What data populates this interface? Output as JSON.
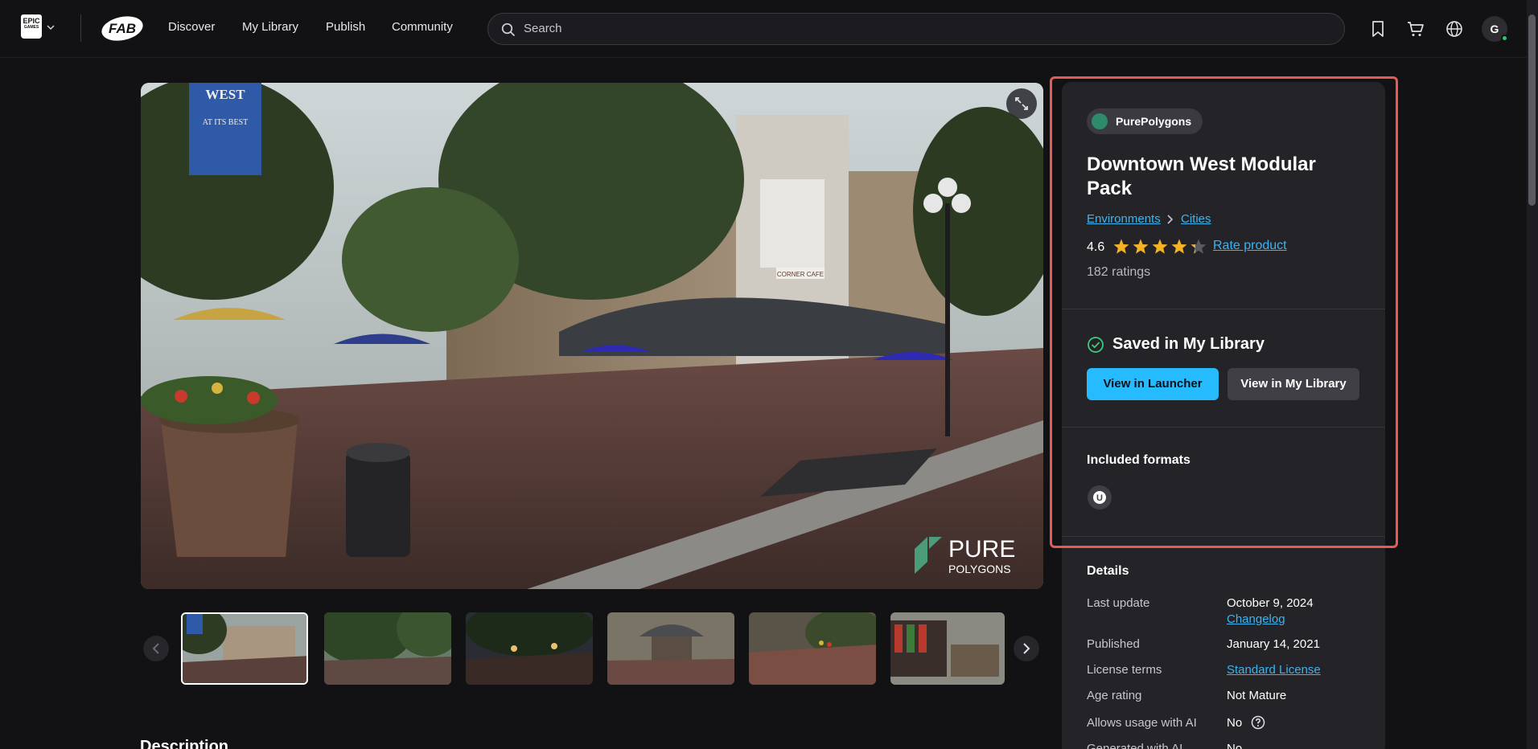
{
  "nav": {
    "epic_logo_text": "EPIC",
    "epic_logo_sub": "GAMES",
    "links": [
      "Discover",
      "My Library",
      "Publish",
      "Community"
    ],
    "search_placeholder": "Search",
    "avatar_initial": "G"
  },
  "gallery": {
    "watermark_line1": "PURE",
    "watermark_line2": "POLYGONS",
    "sign_text_1": "WEST",
    "sign_text_2": "AT ITS BEST",
    "cafe_sign": "CORNER CAFE"
  },
  "product": {
    "seller": "PurePolygons",
    "title": "Downtown West Modular Pack",
    "breadcrumb": [
      "Environments",
      "Cities"
    ],
    "rating": "4.6",
    "rating_value": 4.6,
    "rate_label": "Rate product",
    "ratings_count": "182 ratings",
    "saved_label": "Saved in My Library",
    "btn_launcher": "View in Launcher",
    "btn_library": "View in My Library",
    "formats_heading": "Included formats"
  },
  "details": {
    "heading": "Details",
    "last_update_label": "Last update",
    "last_update_value": "October 9, 2024",
    "changelog_link": "Changelog",
    "published_label": "Published",
    "published_value": "January 14, 2021",
    "license_label": "License terms",
    "license_value": "Standard License",
    "age_label": "Age rating",
    "age_value": "Not Mature",
    "ai_label": "Allows usage with AI",
    "ai_value": "No",
    "generated_label": "Generated with AI",
    "generated_value": "No"
  },
  "description_heading": "Description",
  "colors": {
    "accent": "#26bbff",
    "link": "#3db3f0",
    "star": "#f5b324",
    "highlight": "#e55a55",
    "panel": "#242428"
  }
}
